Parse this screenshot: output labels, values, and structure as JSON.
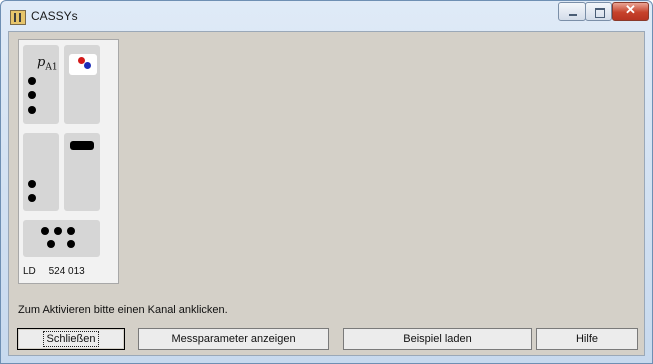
{
  "window": {
    "title": "CASSYs",
    "controls": {
      "minimize": "minimize-icon",
      "maximize": "maximize-icon",
      "close": "✕"
    }
  },
  "device": {
    "sensor_symbol": "p",
    "sensor_subscript": "A1",
    "manufacturer": "LD",
    "article_number": "524 013"
  },
  "hint": "Zum Aktivieren bitte einen Kanal anklicken.",
  "buttons": {
    "close": "Schließen",
    "show_params": "Messparameter anzeigen",
    "load_example": "Beispiel laden",
    "help": "Hilfe"
  }
}
